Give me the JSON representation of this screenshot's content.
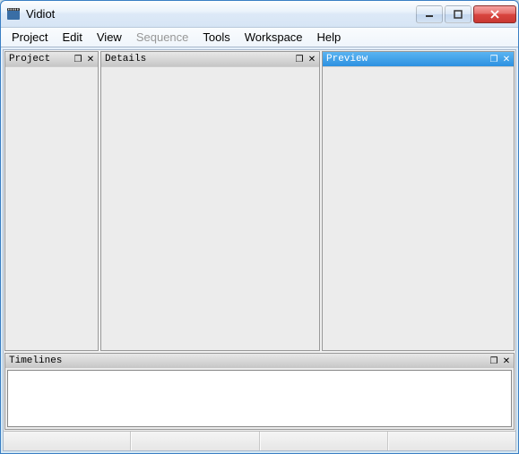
{
  "window": {
    "title": "Vidiot"
  },
  "menubar": {
    "items": [
      {
        "label": "Project",
        "enabled": true
      },
      {
        "label": "Edit",
        "enabled": true
      },
      {
        "label": "View",
        "enabled": true
      },
      {
        "label": "Sequence",
        "enabled": false
      },
      {
        "label": "Tools",
        "enabled": true
      },
      {
        "label": "Workspace",
        "enabled": true
      },
      {
        "label": "Help",
        "enabled": true
      }
    ]
  },
  "panels": {
    "project": {
      "title": "Project",
      "active": false
    },
    "details": {
      "title": "Details",
      "active": false
    },
    "preview": {
      "title": "Preview",
      "active": true
    },
    "timelines": {
      "title": "Timelines",
      "active": false
    }
  }
}
